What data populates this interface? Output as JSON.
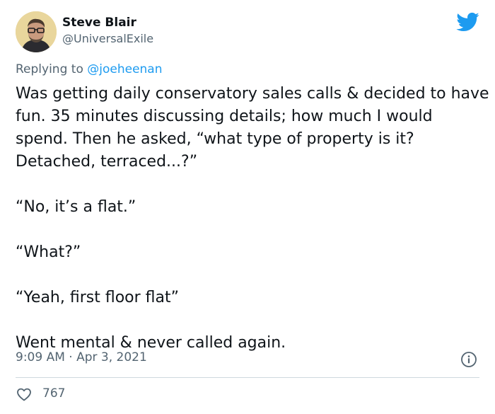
{
  "author": {
    "display_name": "Steve Blair",
    "handle": "@UniversalExile"
  },
  "reply": {
    "prefix": "Replying to",
    "handle": "@joeheenan"
  },
  "body": {
    "p1": "Was getting daily conservatory sales calls & decided to have fun. 35 minutes discussing details; how much I would spend. Then he asked, “what type of property is it? Detached, terraced...?”",
    "p2": "“No, it’s a flat.”",
    "p3": "“What?”",
    "p4": "“Yeah, first floor flat”",
    "p5": "Went mental & never called again."
  },
  "meta": {
    "time": "9:09 AM",
    "separator": "·",
    "date": "Apr 3, 2021"
  },
  "engagement": {
    "likes": "767"
  },
  "colors": {
    "brand_blue": "#1d9bf0",
    "text_secondary": "#536471",
    "text_primary": "#0f1419",
    "divider": "#cfd9de"
  },
  "icons": {
    "brand": "twitter-bird-icon",
    "info": "info-icon",
    "like": "heart-icon"
  }
}
